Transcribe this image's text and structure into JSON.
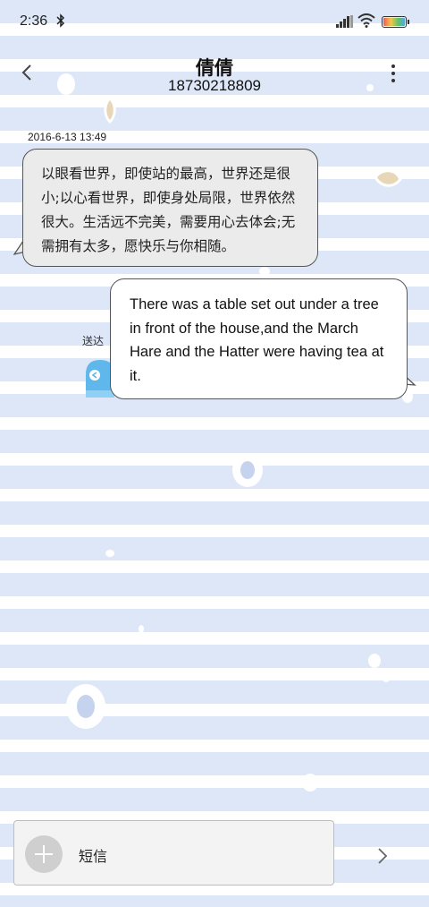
{
  "status_bar": {
    "time": "2:36"
  },
  "header": {
    "contact_name": "倩倩",
    "contact_number": "18730218809"
  },
  "messages": [
    {
      "direction": "incoming",
      "timestamp": "2016-6-13 13:49",
      "text": "以眼看世界，即使站的最高，世界还是很小;以心看世界，即使身处局限，世界依然很大。生活远不完美，需要用心去体会;无需拥有太多，愿快乐与你相随。"
    },
    {
      "direction": "outgoing",
      "status": "送达",
      "text": "There was a table set out under a tree in front of the house,and the March Hare and the Hatter were having tea at it."
    }
  ],
  "compose": {
    "placeholder": "短信"
  },
  "icons": {
    "back": "chevron-left-icon",
    "more": "more-vertical-icon",
    "add": "plus-icon",
    "send": "chevron-right-icon"
  }
}
